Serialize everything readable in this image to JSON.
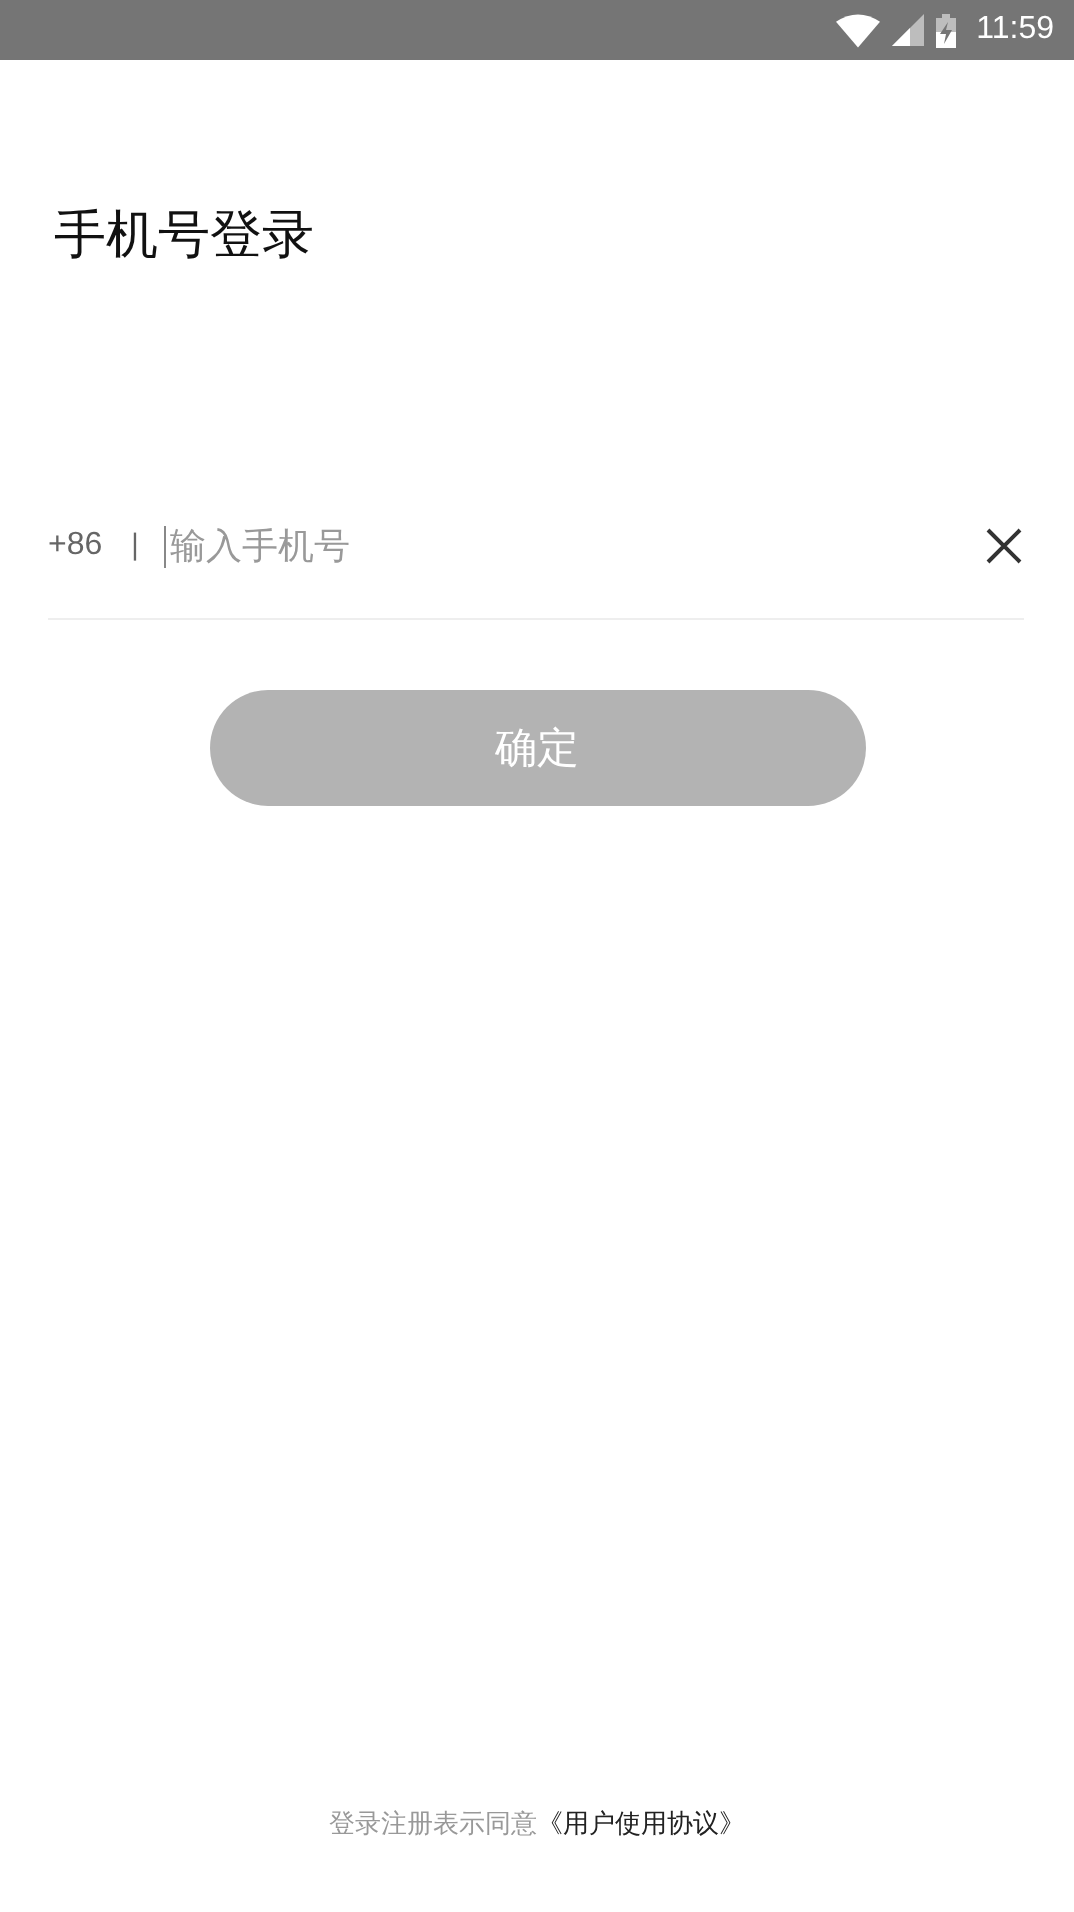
{
  "status_bar": {
    "time": "11:59"
  },
  "title": "手机号登录",
  "phone_field": {
    "country_code": "+86",
    "separator": "|",
    "placeholder": "输入手机号"
  },
  "confirm_button": {
    "label": "确定",
    "disabled": true
  },
  "agreement": {
    "text": "登录注册表示同意",
    "link": "《用户使用协议》"
  }
}
